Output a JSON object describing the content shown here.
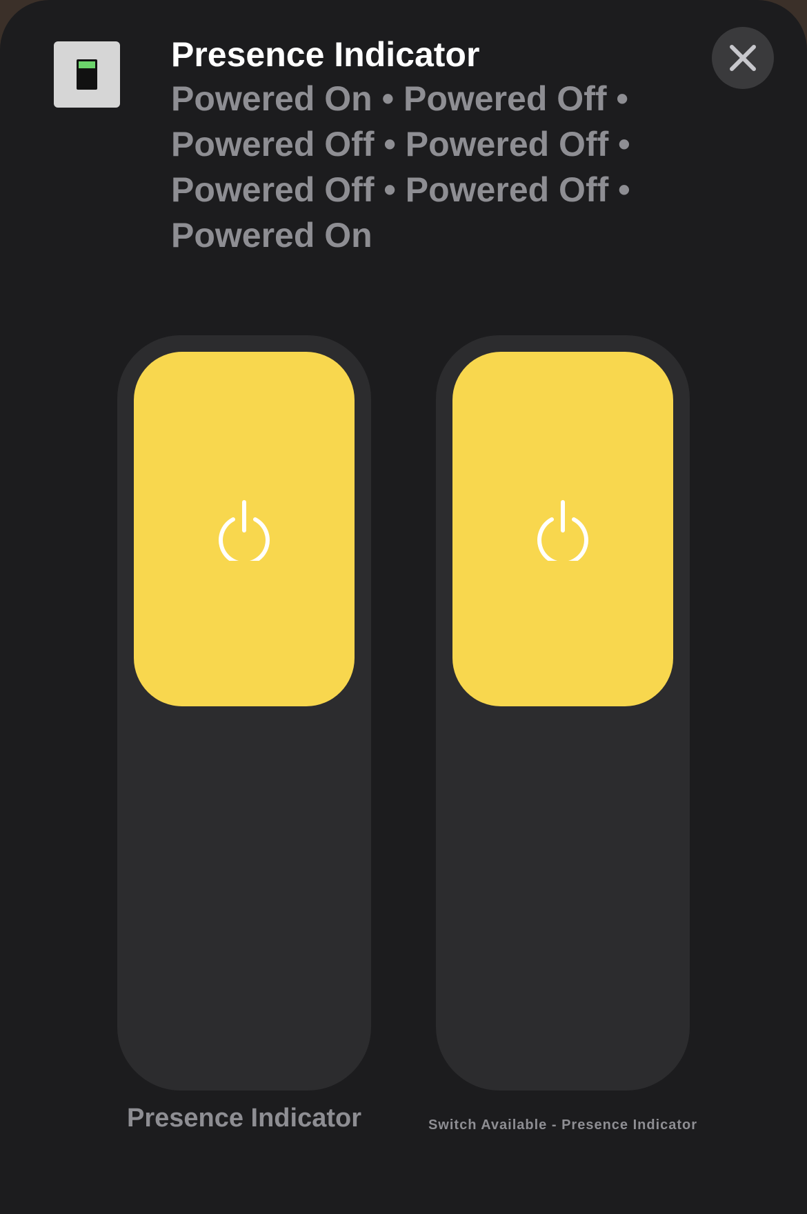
{
  "header": {
    "title": "Presence Indicator",
    "status": "Powered On • Powered Off • Powered Off • Powered Off • Powered Off • Powered Off • Powered On",
    "icon": "light-switch-icon"
  },
  "close_button": {
    "icon": "close-icon"
  },
  "tiles": [
    {
      "label": "Presence Indicator",
      "icon": "power-icon",
      "level_percent": 47
    },
    {
      "label": "Switch Available - Presence Indicator",
      "icon": "power-icon",
      "level_percent": 47
    }
  ],
  "colors": {
    "accent": "#f8d74e",
    "background": "#1c1c1e",
    "tile_track": "#2c2c2e",
    "secondary_text": "#8e8e93",
    "indicator_green": "#6cd36b"
  }
}
